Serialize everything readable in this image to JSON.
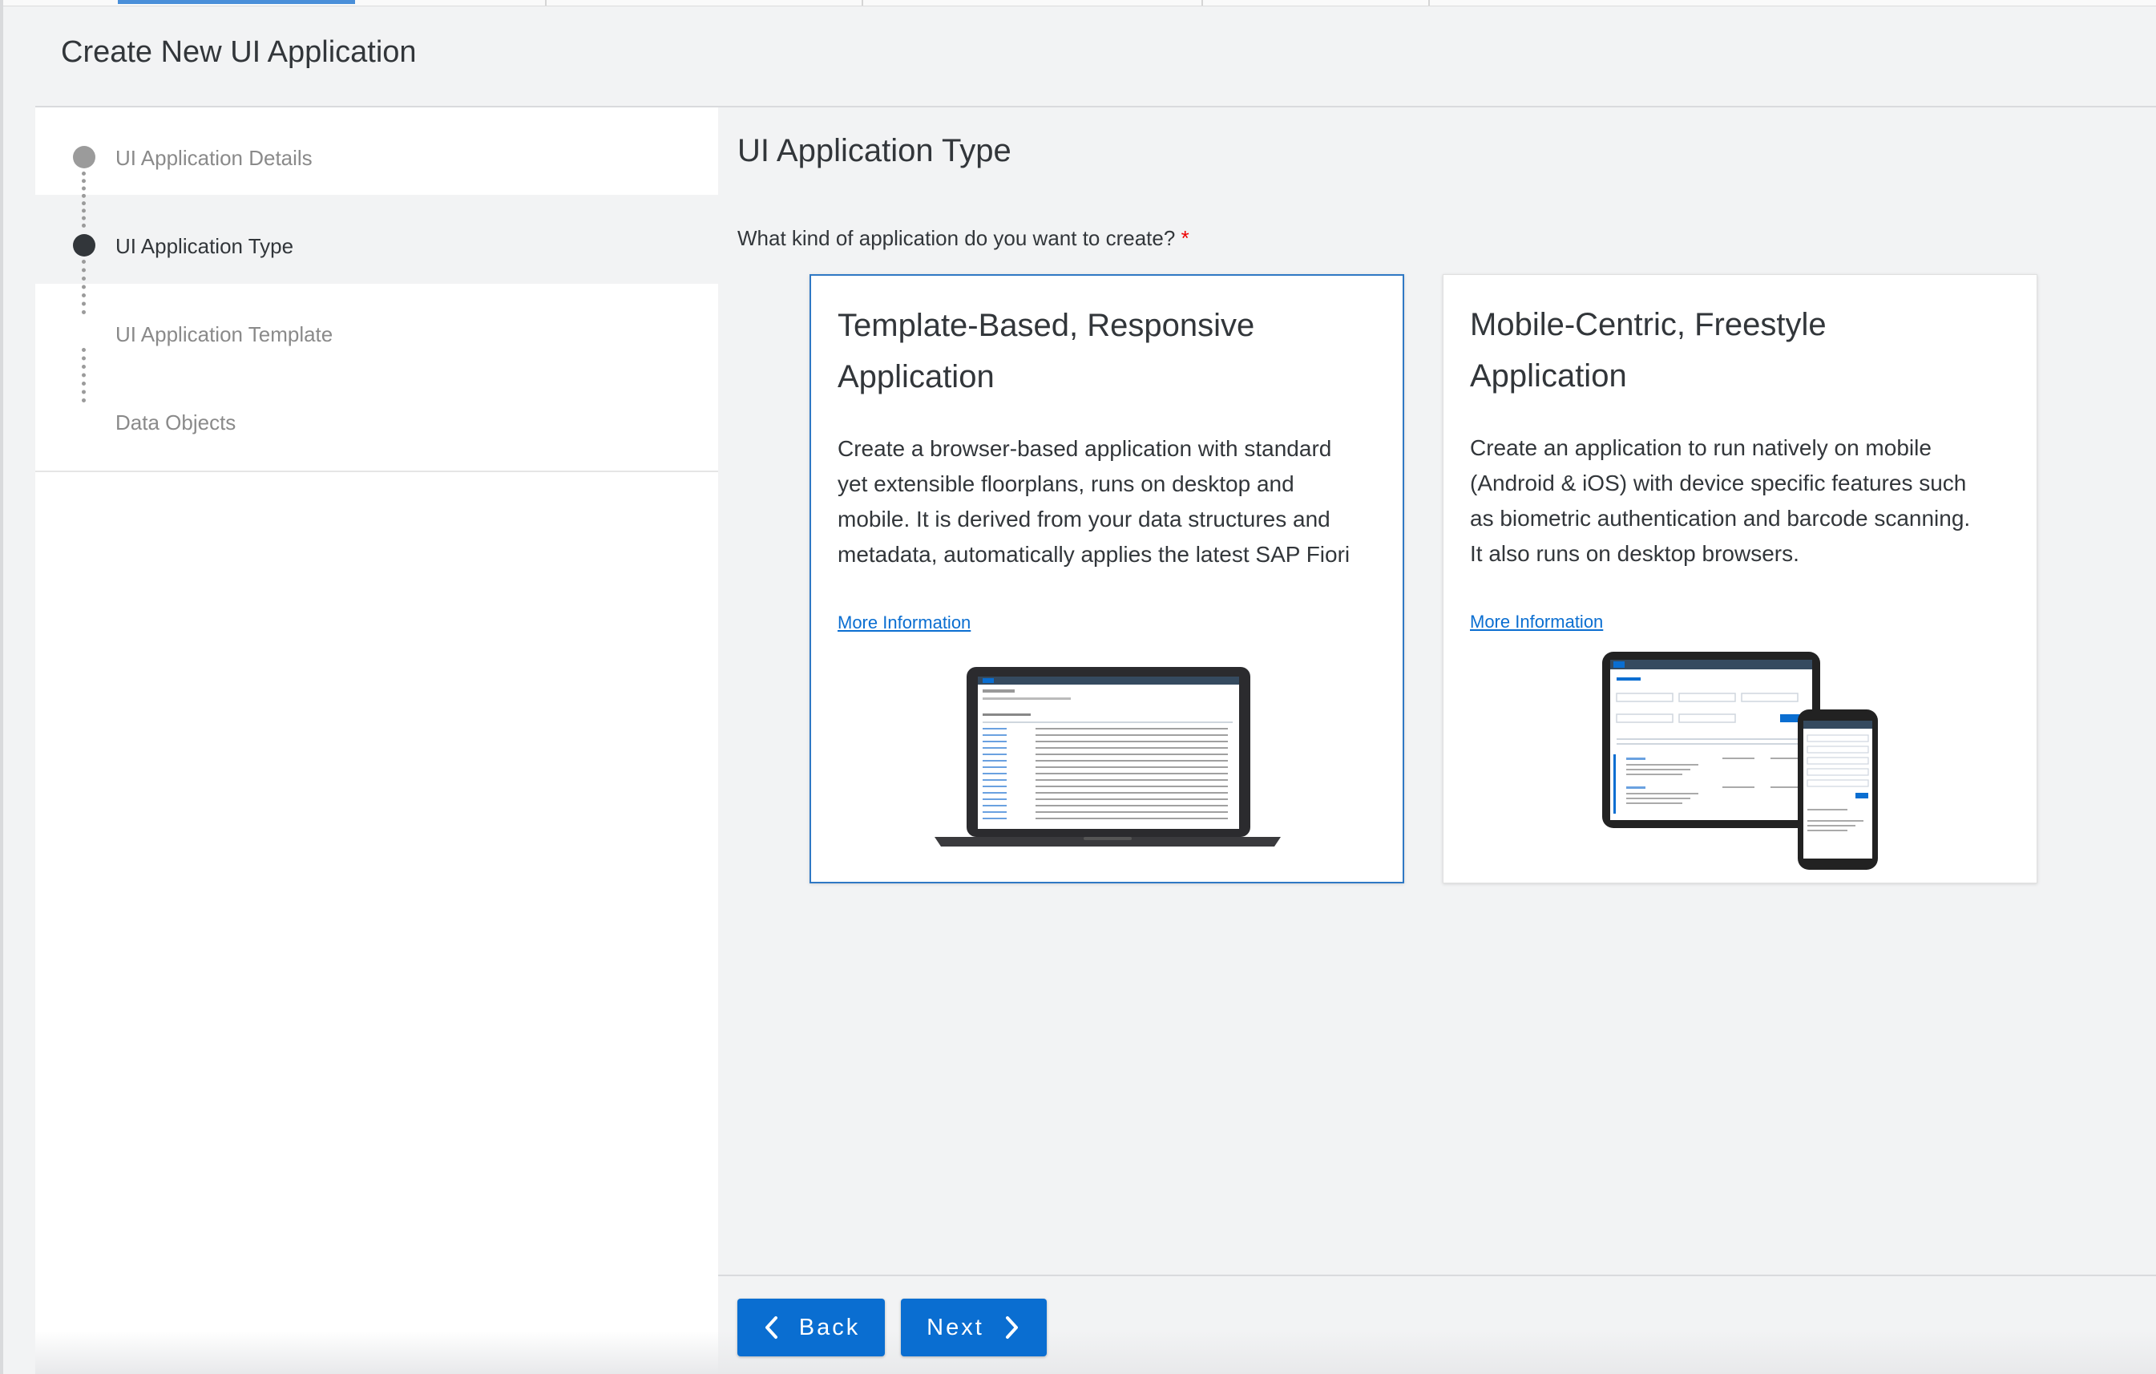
{
  "page": {
    "title": "Create New UI Application"
  },
  "steps": [
    {
      "label": "UI Application Details",
      "state": "completed"
    },
    {
      "label": "UI Application Type",
      "state": "current"
    },
    {
      "label": "UI Application Template",
      "state": "upcoming"
    },
    {
      "label": "Data Objects",
      "state": "upcoming"
    }
  ],
  "main": {
    "title": "UI Application Type",
    "question": "What kind of application do you want to create?",
    "required_marker": "*"
  },
  "cards": [
    {
      "title_line1": "Template-Based, Responsive",
      "title_line2": "Application",
      "desc_lines": [
        "Create a browser-based application with standard",
        "yet extensible floorplans, runs on desktop and",
        "mobile. It is derived from your data structures and",
        "metadata, automatically applies the latest SAP Fiori"
      ],
      "link": "More Information",
      "image": "laptop-preview",
      "selected": true
    },
    {
      "title_line1": "Mobile-Centric, Freestyle",
      "title_line2": "Application",
      "desc_lines": [
        "Create an application to run natively on mobile",
        "(Android & iOS) with device specific features such",
        "as biometric authentication and barcode scanning.",
        "It also runs on desktop browsers."
      ],
      "link": "More Information",
      "image": "tablet-phone-preview",
      "selected": false
    }
  ],
  "footer": {
    "back_label": "Back",
    "next_label": "Next",
    "back_icon": "chevron-left-icon",
    "next_icon": "chevron-right-icon"
  },
  "colors": {
    "accent": "#0a6ed1",
    "selected_border": "#2f78c4",
    "background": "#f2f3f4",
    "text": "#32363a",
    "required": "#ee0000"
  }
}
